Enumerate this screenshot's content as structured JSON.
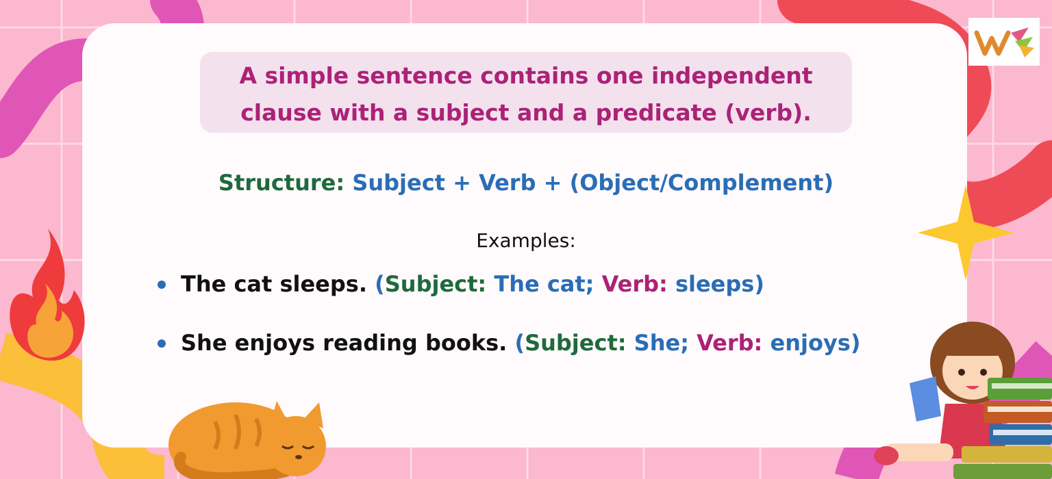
{
  "headline": {
    "line1": "A simple sentence contains one independent",
    "line2": "clause with a subject and a predicate (verb)."
  },
  "structure": {
    "label": "Structure",
    "colon": ":",
    "formula": "Subject + Verb + (Object/Complement)"
  },
  "examples_heading": "Examples:",
  "examples": [
    {
      "sentence": "The cat sleeps.",
      "open_paren": "(",
      "subject_label": "Subject",
      "subject_colon": ":",
      "subject_value": "The cat;",
      "verb_label": "Verb",
      "verb_colon": ":",
      "verb_value": "sleeps)"
    },
    {
      "sentence": "She enjoys reading books.",
      "open_paren": "(",
      "subject_label": "Subject",
      "subject_colon": ":",
      "subject_value": "She;",
      "verb_label": "Verb",
      "verb_colon": ":",
      "verb_value": "enjoys)"
    }
  ],
  "colors": {
    "headline_text": "#ab2277",
    "headline_bg": "#f4e1ee",
    "structure_label": "#1e6a3c",
    "structure_formula": "#2a6db5",
    "subject": "#1e6a3c",
    "verb": "#ab2277",
    "paren_values": "#2a6db5",
    "background": "#fbb8cf",
    "grid_lines": "#ffd9e6"
  },
  "icons": [
    "brand-logo-icon",
    "flame-icon",
    "sleeping-cat-icon",
    "star-burst-icon",
    "girl-reading-icon",
    "book-stack-icon"
  ]
}
